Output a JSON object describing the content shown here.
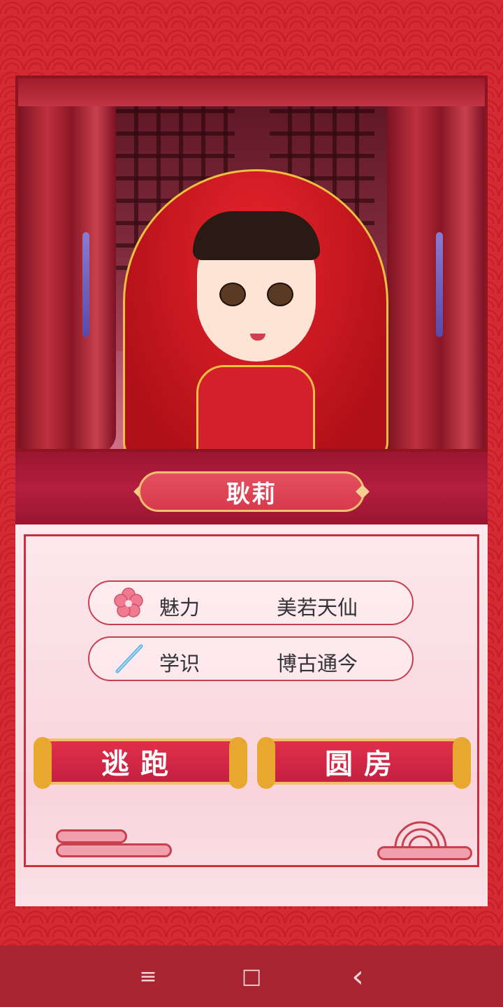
{
  "character": {
    "name": "耿莉",
    "stats": [
      {
        "icon": "plum-blossom-icon",
        "label": "魅力",
        "value": "美若天仙"
      },
      {
        "icon": "brush-icon",
        "label": "学识",
        "value": "博古通今"
      }
    ]
  },
  "actions": {
    "flee": "逃跑",
    "consummate": "圆房"
  },
  "nav": {
    "menu": "≡",
    "home": "□",
    "back": "‹"
  },
  "colors": {
    "background": "#d42a34",
    "accent": "#c8303e",
    "gold": "#f2c060"
  }
}
